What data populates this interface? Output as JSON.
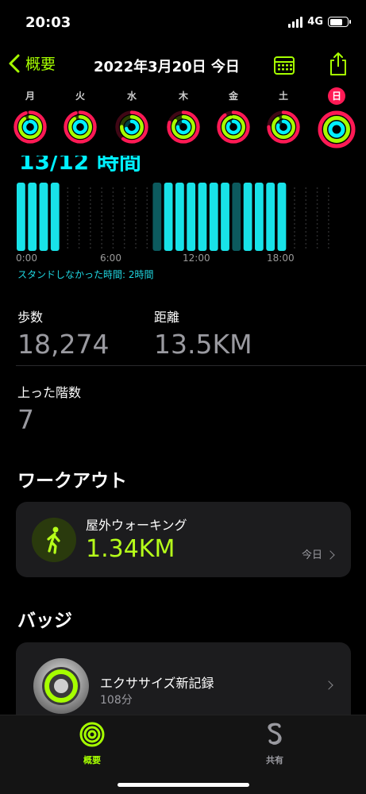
{
  "status": {
    "time": "20:03",
    "network": "4G",
    "battery_level": 0.75
  },
  "nav": {
    "back_label": "概要",
    "title": "2022年3月20日 今日"
  },
  "week": [
    {
      "label": "月",
      "move": 0.95,
      "exercise": 0.9,
      "stand": 0.9,
      "today": false
    },
    {
      "label": "火",
      "move": 0.95,
      "exercise": 0.9,
      "stand": 0.95,
      "today": false
    },
    {
      "label": "水",
      "move": 0.6,
      "exercise": 0.75,
      "stand": 0.7,
      "today": false
    },
    {
      "label": "木",
      "move": 0.8,
      "exercise": 0.85,
      "stand": 0.75,
      "today": false
    },
    {
      "label": "金",
      "move": 0.9,
      "exercise": 0.95,
      "stand": 0.85,
      "today": false
    },
    {
      "label": "土",
      "move": 0.75,
      "exercise": 0.9,
      "stand": 0.8,
      "today": false
    },
    {
      "label": "日",
      "move": 1.0,
      "exercise": 1.0,
      "stand": 1.0,
      "today": true
    }
  ],
  "stand": {
    "value": "13/12 時間",
    "hours": [
      1,
      1,
      1,
      1,
      0,
      0,
      0,
      0,
      0,
      0,
      0,
      0,
      2,
      1,
      1,
      1,
      1,
      1,
      1,
      2,
      1,
      1,
      1,
      1,
      0,
      0,
      0,
      0
    ],
    "axis_labels": [
      "0:00",
      "6:00",
      "12:00",
      "18:00"
    ],
    "note": "スタンドしなかった時間: 2時間"
  },
  "metrics": {
    "steps_label": "歩数",
    "steps_value": "18,274",
    "distance_label": "距離",
    "distance_value": "13.5KM",
    "floors_label": "上った階数",
    "floors_value": "7"
  },
  "workouts": {
    "title": "ワークアウト",
    "item": {
      "name": "屋外ウォーキング",
      "distance": "1.34KM",
      "date": "今日"
    }
  },
  "badges": {
    "title": "バッジ",
    "item": {
      "name": "エクササイズ新記録",
      "sub": "108分"
    }
  },
  "tabs": {
    "summary": "概要",
    "sharing": "共有"
  },
  "colors": {
    "accent": "#a6ff00",
    "move": "#ff1a55",
    "exercise": "#a6ff00",
    "stand": "#00f0ff"
  }
}
